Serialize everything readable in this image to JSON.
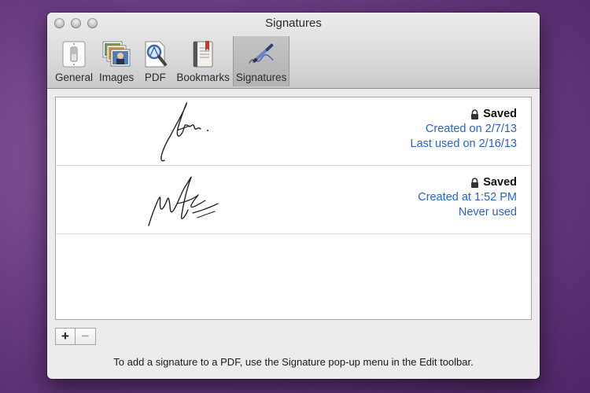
{
  "window": {
    "title": "Signatures"
  },
  "toolbar": {
    "tabs": [
      {
        "label": "General",
        "icon": "light-switch-icon"
      },
      {
        "label": "Images",
        "icon": "photos-icon"
      },
      {
        "label": "PDF",
        "icon": "pdf-magnifier-icon"
      },
      {
        "label": "Bookmarks",
        "icon": "bookmark-book-icon"
      },
      {
        "label": "Signatures",
        "icon": "signature-pen-icon"
      }
    ],
    "selected": "Signatures"
  },
  "signatures": [
    {
      "status": "Saved",
      "line1": "Created on 2/7/13",
      "line2": "Last used on 2/16/13"
    },
    {
      "status": "Saved",
      "line1": "Created at 1:52 PM",
      "line2": "Never used"
    }
  ],
  "buttons": {
    "add": "+",
    "remove": "−"
  },
  "footer": {
    "hint": "To add a signature to a PDF, use the Signature pop-up menu in the Edit toolbar."
  },
  "colors": {
    "link": "#2c62c4",
    "selected_tab": "#b8b8b8",
    "desktop": "#6d3f86"
  }
}
